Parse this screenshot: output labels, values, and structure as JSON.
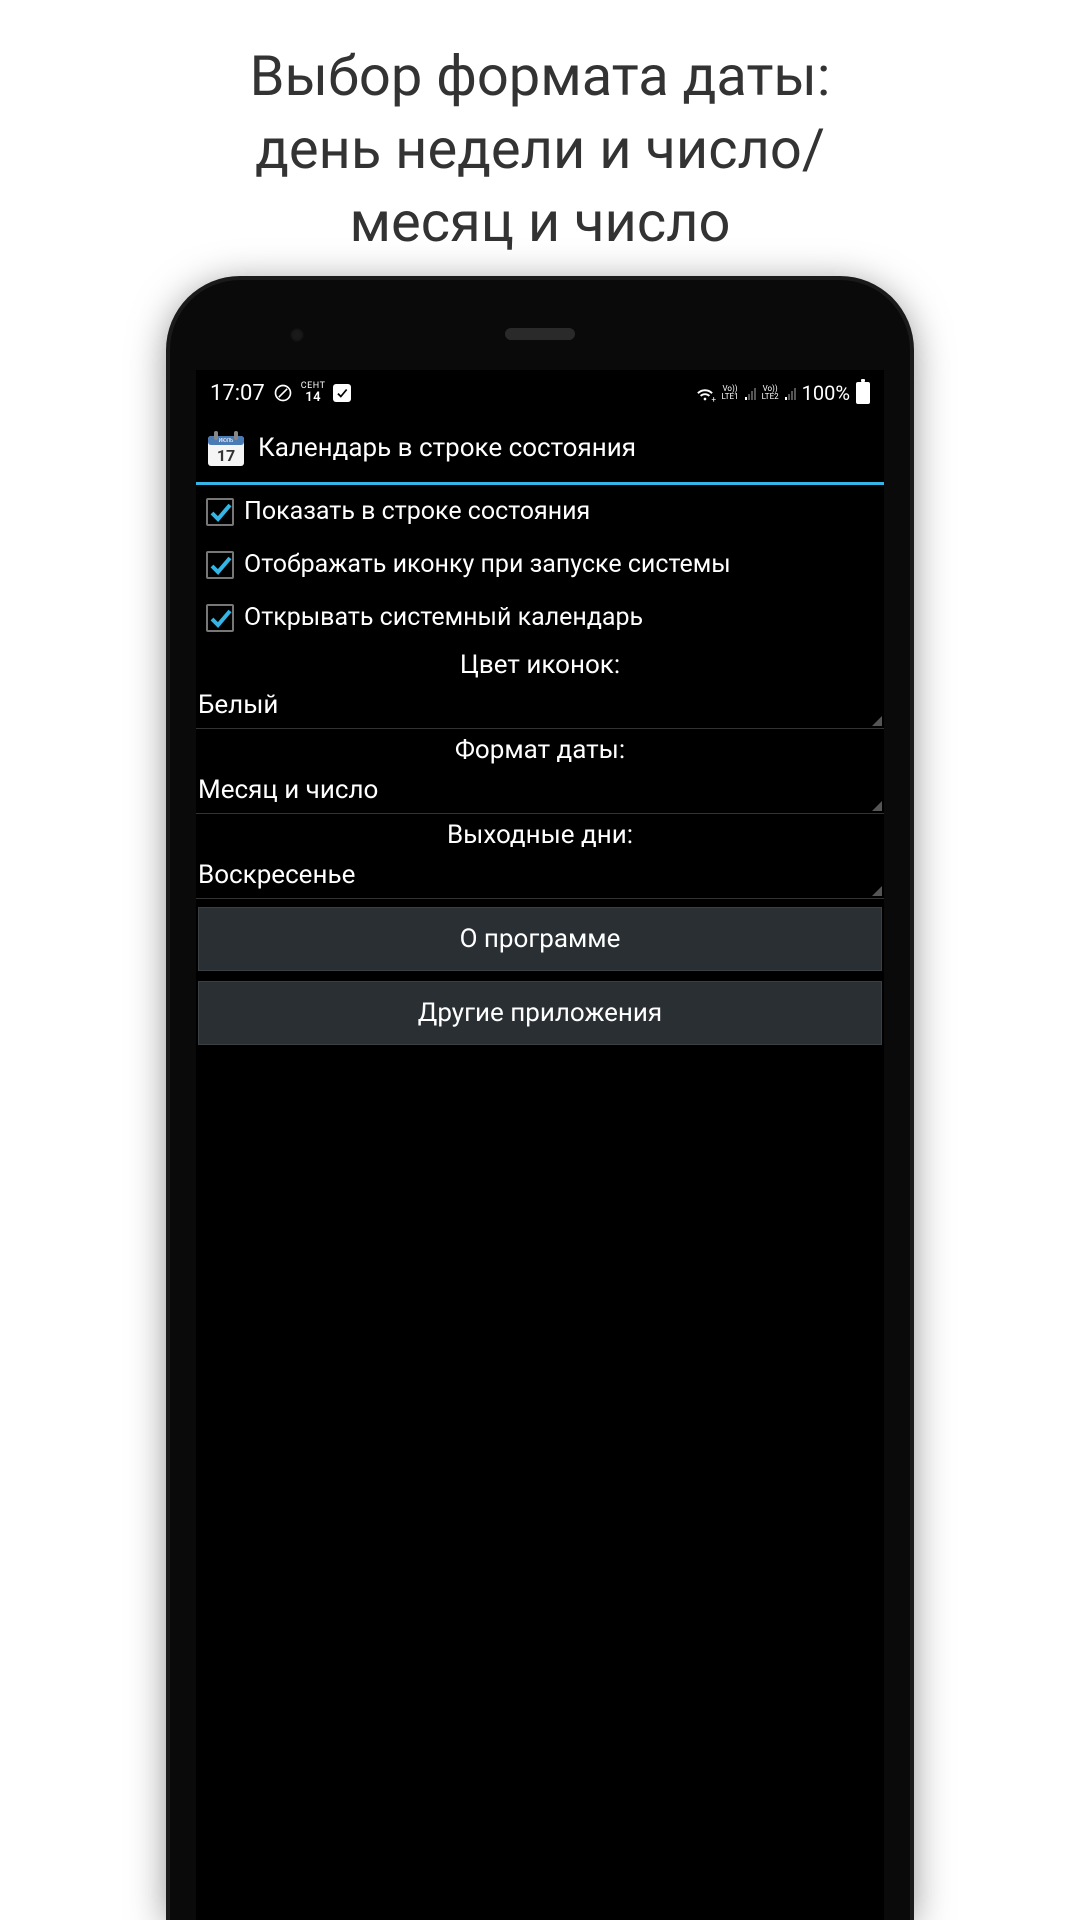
{
  "promo": {
    "line1": "Выбор формата даты:",
    "line2": "день недели и число/",
    "line3": "месяц и число"
  },
  "status_bar": {
    "time": "17:07",
    "date_month": "СЕНТ",
    "date_day": "14",
    "lte1": "LTE1",
    "lte2": "LTE2",
    "vo1": "Vo))",
    "vo2": "Vo))",
    "battery_pct": "100%"
  },
  "header": {
    "app_title": "Календарь в строке состояния",
    "icon_day": "17",
    "icon_month": "ИЮЛЬ"
  },
  "checkboxes": [
    {
      "label": "Показать в строке состояния",
      "checked": true
    },
    {
      "label": "Отображать иконку при запуске системы",
      "checked": true
    },
    {
      "label": "Открывать системный календарь",
      "checked": true
    }
  ],
  "sections": {
    "icon_color": {
      "label": "Цвет иконок:",
      "value": "Белый"
    },
    "date_format": {
      "label": "Формат даты:",
      "value": "Месяц и число"
    },
    "weekend": {
      "label": "Выходные дни:",
      "value": "Воскресенье"
    }
  },
  "buttons": {
    "about": "О программе",
    "other_apps": "Другие приложения"
  }
}
